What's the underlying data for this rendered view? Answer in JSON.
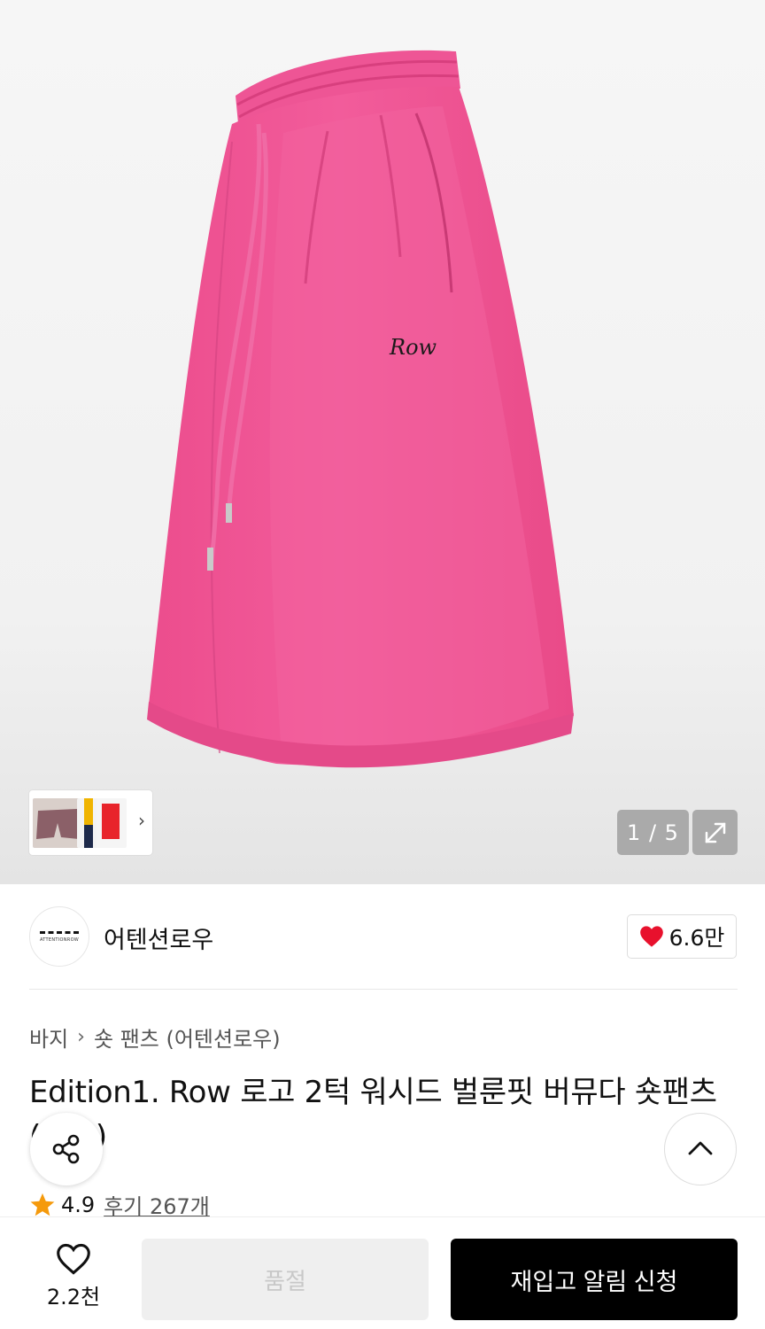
{
  "gallery": {
    "counter": "1 / 5"
  },
  "brand": {
    "name": "어텐션로우",
    "logo_text": "ATTENTIONROW",
    "like_count": "6.6만"
  },
  "breadcrumb": {
    "category": "바지",
    "subcategory": "숏 팬츠 (어텐션로우)"
  },
  "product": {
    "title": "Edition1. Row 로고 2턱 워시드 벌룬핏 버뮤다 숏팬츠 (핑크)",
    "logo_mark": "Row"
  },
  "rating": {
    "score": "4.9",
    "reviews": "후기 267개"
  },
  "bottom_bar": {
    "wish_count": "2.2천",
    "soldout_label": "품절",
    "restock_label": "재입고 알림 신청"
  },
  "colors": {
    "product_pink": "#f05a98",
    "like_red": "#e8112d",
    "star_orange": "#f59a0c",
    "button_black": "#000000"
  }
}
